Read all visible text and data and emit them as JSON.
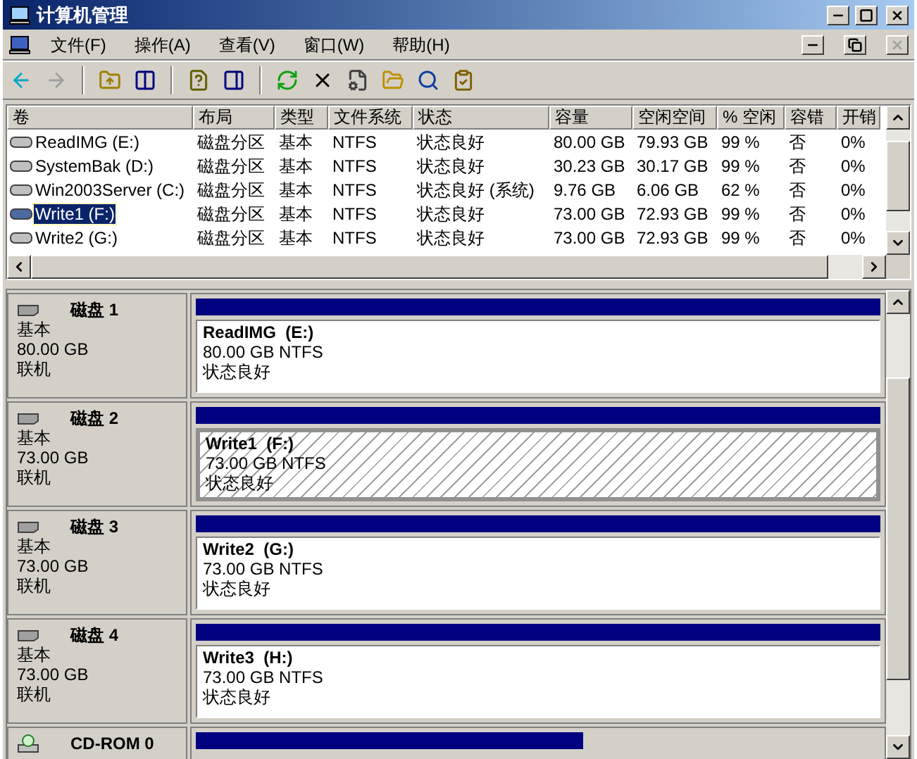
{
  "window": {
    "title": "计算机管理"
  },
  "menu": [
    "文件(F)",
    "操作(A)",
    "查看(V)",
    "窗口(W)",
    "帮助(H)"
  ],
  "toolbar": [
    {
      "kind": "back",
      "disabled": false
    },
    {
      "kind": "forward",
      "disabled": true
    },
    {
      "kind": "up",
      "disabled": false
    },
    {
      "kind": "tree",
      "disabled": false
    },
    {
      "kind": "help",
      "disabled": false
    },
    {
      "kind": "pane",
      "disabled": false
    },
    {
      "kind": "refresh",
      "disabled": false
    },
    {
      "kind": "delete",
      "disabled": false
    },
    {
      "kind": "properties",
      "disabled": false
    },
    {
      "kind": "open",
      "disabled": false
    },
    {
      "kind": "find",
      "disabled": false
    },
    {
      "kind": "settings",
      "disabled": false
    }
  ],
  "table": {
    "columns": [
      "卷",
      "布局",
      "类型",
      "文件系统",
      "状态",
      "容量",
      "空闲空间",
      "% 空闲",
      "容错",
      "开销"
    ],
    "rows": [
      {
        "cells": [
          "ReadIMG (E:)",
          "磁盘分区",
          "基本",
          "NTFS",
          "状态良好",
          "80.00 GB",
          "79.93 GB",
          "99 %",
          "否",
          "0%"
        ],
        "selected": false
      },
      {
        "cells": [
          "SystemBak (D:)",
          "磁盘分区",
          "基本",
          "NTFS",
          "状态良好",
          "30.23 GB",
          "30.17 GB",
          "99 %",
          "否",
          "0%"
        ],
        "selected": false
      },
      {
        "cells": [
          "Win2003Server (C:)",
          "磁盘分区",
          "基本",
          "NTFS",
          "状态良好 (系统)",
          "9.76 GB",
          "6.06 GB",
          "62 %",
          "否",
          "0%"
        ],
        "selected": false
      },
      {
        "cells": [
          "Write1 (F:)",
          "磁盘分区",
          "基本",
          "NTFS",
          "状态良好",
          "73.00 GB",
          "72.93 GB",
          "99 %",
          "否",
          "0%"
        ],
        "selected": true
      },
      {
        "cells": [
          "Write2 (G:)",
          "磁盘分区",
          "基本",
          "NTFS",
          "状态良好",
          "73.00 GB",
          "72.93 GB",
          "99 %",
          "否",
          "0%"
        ],
        "selected": false
      }
    ]
  },
  "disks": [
    {
      "kind": "disk",
      "name": "磁盘 1",
      "type": "基本",
      "size": "80.00 GB",
      "status": "联机",
      "partitions": [
        {
          "name": "ReadIMG  (E:)",
          "detail": "80.00 GB NTFS",
          "status": "状态良好",
          "selected": false
        }
      ]
    },
    {
      "kind": "disk",
      "name": "磁盘 2",
      "type": "基本",
      "size": "73.00 GB",
      "status": "联机",
      "partitions": [
        {
          "name": "Write1  (F:)",
          "detail": "73.00 GB NTFS",
          "status": "状态良好",
          "selected": true
        }
      ]
    },
    {
      "kind": "disk",
      "name": "磁盘 3",
      "type": "基本",
      "size": "73.00 GB",
      "status": "联机",
      "partitions": [
        {
          "name": "Write2  (G:)",
          "detail": "73.00 GB NTFS",
          "status": "状态良好",
          "selected": false
        }
      ]
    },
    {
      "kind": "disk",
      "name": "磁盘 4",
      "type": "基本",
      "size": "73.00 GB",
      "status": "联机",
      "partitions": [
        {
          "name": "Write3  (H:)",
          "detail": "73.00 GB NTFS",
          "status": "状态良好",
          "selected": false
        }
      ]
    },
    {
      "kind": "cdrom",
      "name": "CD-ROM 0"
    }
  ]
}
